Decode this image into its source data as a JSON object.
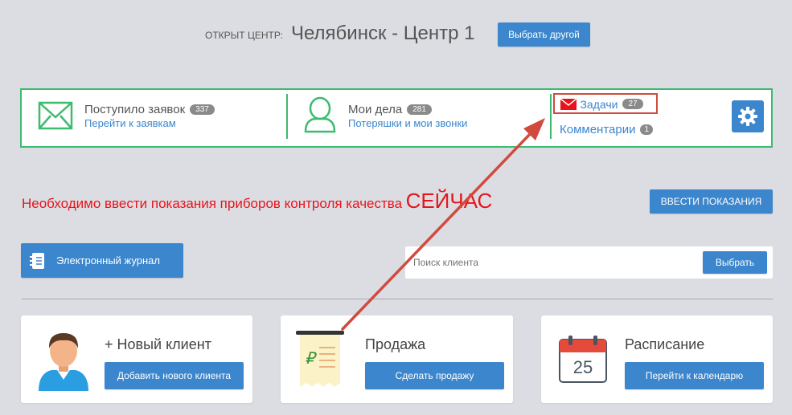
{
  "header": {
    "open_center_label": "ОТКРЫТ ЦЕНТР:",
    "center_name": "Челябинск - Центр 1",
    "choose_other": "Выбрать другой"
  },
  "panel": {
    "requests": {
      "title": "Поступило заявок",
      "count": "337",
      "link": "Перейти к заявкам"
    },
    "my_tasks": {
      "title": "Мои дела",
      "count": "281",
      "link": "Потеряшки и мои звонки"
    },
    "tasks": {
      "title": "Задачи",
      "count": "27"
    },
    "comments": {
      "title": "Комментарии",
      "count": "1"
    }
  },
  "alert": {
    "text": "Необходимо ввести показания приборов контроля качества",
    "emphasis": "СЕЙЧАС",
    "button": "ВВЕСТИ ПОКАЗАНИЯ"
  },
  "journal_button": "Электронный журнал",
  "search": {
    "placeholder": "Поиск клиента",
    "button": "Выбрать"
  },
  "cards": [
    {
      "title": "+ Новый клиент",
      "button": "Добавить нового клиента"
    },
    {
      "title": "Продажа",
      "button": "Сделать продажу"
    },
    {
      "title": "Расписание",
      "button": "Перейти к календарю",
      "calendar_day": "25"
    }
  ],
  "colors": {
    "accent": "#3b86cc",
    "panel_border": "#3dbb6e",
    "alert": "#e8141b",
    "annotation": "#d04b3e"
  }
}
